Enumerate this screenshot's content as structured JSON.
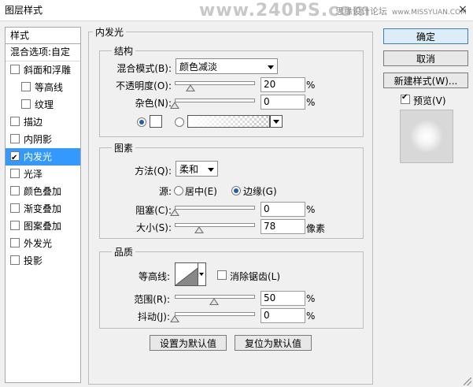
{
  "window": {
    "title": "图层样式",
    "watermark": "www.240PS.com",
    "watermark_side": "思缘设计论坛",
    "watermark_url": "www.MISSYUAN.COM",
    "close_icon": "×"
  },
  "sidebar": {
    "header": "样式",
    "blend_options": "混合选项:自定",
    "items": [
      {
        "label": "斜面和浮雕",
        "checked": false
      },
      {
        "label": "等高线",
        "checked": false,
        "sub": true
      },
      {
        "label": "纹理",
        "checked": false,
        "sub": true
      },
      {
        "label": "描边",
        "checked": false
      },
      {
        "label": "内阴影",
        "checked": false
      },
      {
        "label": "内发光",
        "checked": true,
        "selected": true
      },
      {
        "label": "光泽",
        "checked": false
      },
      {
        "label": "颜色叠加",
        "checked": false
      },
      {
        "label": "渐变叠加",
        "checked": false
      },
      {
        "label": "图案叠加",
        "checked": false
      },
      {
        "label": "外发光",
        "checked": false
      },
      {
        "label": "投影",
        "checked": false
      }
    ]
  },
  "panel": {
    "title": "内发光",
    "structure": {
      "title": "结构",
      "blend_mode_label": "混合模式(B):",
      "blend_mode_value": "颜色减淡",
      "opacity_label": "不透明度(O):",
      "opacity_value": "20",
      "opacity_unit": "%",
      "opacity_level": 0.2,
      "noise_label": "杂色(N):",
      "noise_value": "0",
      "noise_unit": "%",
      "noise_level": 0.0,
      "glow_color_mode": "solid"
    },
    "elements": {
      "title": "图素",
      "method_label": "方法(Q):",
      "method_value": "柔和",
      "source_label": "源:",
      "source_center": "居中(E)",
      "source_edge": "边缘(G)",
      "source_selected": "edge",
      "choke_label": "阻塞(C):",
      "choke_value": "0",
      "choke_unit": "%",
      "choke_level": 0.0,
      "size_label": "大小(S):",
      "size_value": "78",
      "size_unit": "像素",
      "size_level": 0.31
    },
    "quality": {
      "title": "品质",
      "contour_label": "等高线:",
      "antialias_label": "消除锯齿(L)",
      "antialias_checked": false,
      "range_label": "范围(R):",
      "range_value": "50",
      "range_unit": "%",
      "range_level": 0.5,
      "jitter_label": "抖动(J):",
      "jitter_value": "0",
      "jitter_unit": "%",
      "jitter_level": 0.0
    },
    "make_default": "设置为默认值",
    "reset_default": "复位为默认值"
  },
  "actions": {
    "ok": "确定",
    "cancel": "取消",
    "new_style": "新建样式(W)...",
    "preview_label": "预览(V)",
    "preview_checked": true
  }
}
